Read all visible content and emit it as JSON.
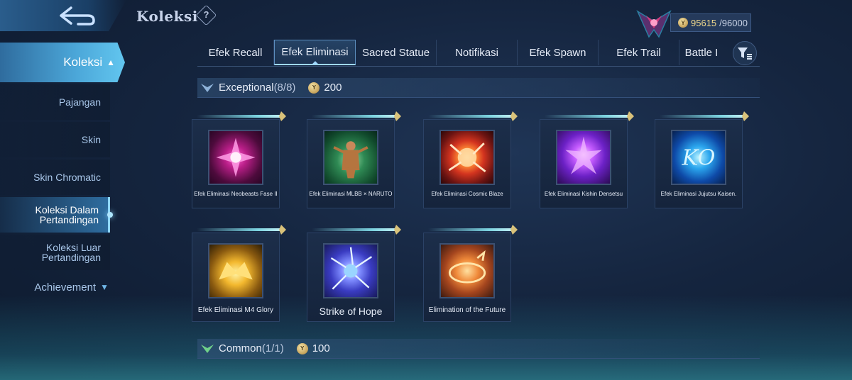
{
  "header": {
    "title": "Koleksi",
    "help_icon": "question-icon",
    "currency_current": "95615",
    "currency_max": "/96000"
  },
  "sidebar": {
    "main_label": "Koleksi",
    "items": [
      {
        "label": "Pajangan"
      },
      {
        "label": "Skin"
      },
      {
        "label": "Skin Chromatic"
      },
      {
        "label": "Koleksi Dalam Pertandingan",
        "active": true
      },
      {
        "label": "Koleksi Luar Pertandingan"
      }
    ],
    "achievement_label": "Achievement"
  },
  "tabs": [
    {
      "label": "Efek Recall"
    },
    {
      "label": "Efek Eliminasi",
      "active": true
    },
    {
      "label": "Sacred Statue"
    },
    {
      "label": "Notifikasi"
    },
    {
      "label": "Efek Spawn"
    },
    {
      "label": "Efek Trail"
    },
    {
      "label": "Battle I"
    }
  ],
  "sections": {
    "exceptional": {
      "name": "Exceptional",
      "count": "(8/8)",
      "cost": "200"
    },
    "common": {
      "name": "Common",
      "count": "(1/1)",
      "cost": "100"
    }
  },
  "cards": [
    {
      "label": "Efek Eliminasi Neobeasts Fase II"
    },
    {
      "label": "Efek Eliminasi MLBB × NARUTO"
    },
    {
      "label": "Efek Eliminasi Cosmic Blaze"
    },
    {
      "label": "Efek Eliminasi Kishin Densetsu"
    },
    {
      "label": "Efek Eliminasi Jujutsu Kaisen."
    },
    {
      "label": "Efek Eliminasi M4 Glory"
    },
    {
      "label": "Strike of Hope"
    },
    {
      "label": "Elimination of the Future"
    }
  ],
  "colors": {
    "accent": "#4ba6d8",
    "gold": "#f0d98c",
    "background": "#15253f"
  }
}
